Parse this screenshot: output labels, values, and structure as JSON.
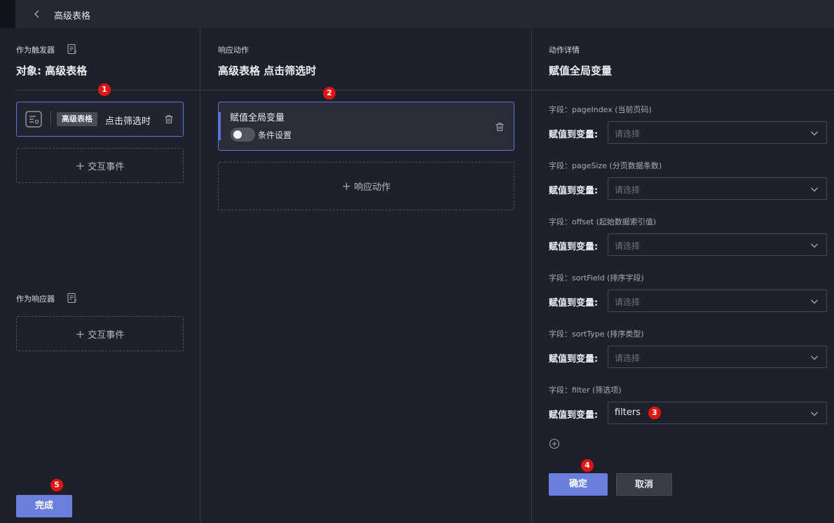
{
  "header": {
    "title": "高级表格"
  },
  "trigger_panel": {
    "label": "作为触发器",
    "object_title": "对象: 高级表格",
    "card": {
      "tag": "高级表格",
      "event": "点击筛选时"
    },
    "add_event_label": "交互事件",
    "responder_label": "作为响应器",
    "responder_add_label": "交互事件",
    "done_label": "完成"
  },
  "response_panel": {
    "label": "响应动作",
    "title": "高级表格 点击筛选时",
    "card": {
      "title": "赋值全局变量",
      "condition_label": "条件设置",
      "condition_enabled": false
    },
    "add_action_label": "响应动作"
  },
  "detail_panel": {
    "label": "动作详情",
    "title": "赋值全局变量",
    "assign_label": "赋值到变量:",
    "placeholder": "请选择",
    "fields": [
      {
        "label": "字段：pageIndex (当前页码)",
        "value": ""
      },
      {
        "label": "字段：pageSize (分页数据条数)",
        "value": ""
      },
      {
        "label": "字段：offset (起始数据索引值)",
        "value": ""
      },
      {
        "label": "字段：sortField (排序字段)",
        "value": ""
      },
      {
        "label": "字段：sortType (排序类型)",
        "value": ""
      },
      {
        "label": "字段：filter (筛选项)",
        "value": "filters"
      }
    ],
    "confirm_label": "确定",
    "cancel_label": "取消"
  },
  "badges": [
    "1",
    "2",
    "3",
    "4",
    "5"
  ],
  "colors": {
    "accent": "#5b76d6",
    "primary_button": "#6a7fdc",
    "badge": "#e01414",
    "background": "#1f2029"
  }
}
